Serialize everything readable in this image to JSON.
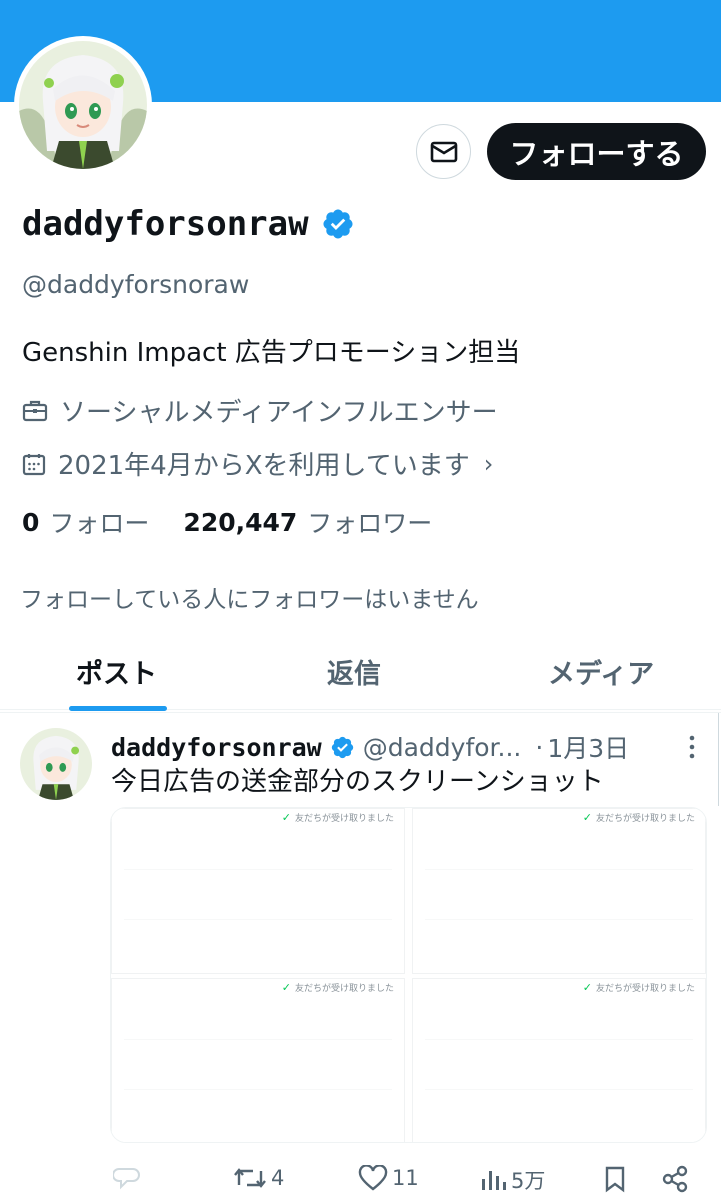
{
  "profile": {
    "display_name": "daddyforsonraw",
    "handle": "@daddyforsnoraw",
    "bio": "Genshin Impact 広告プロモーション担当",
    "category": "ソーシャルメディアインフルエンサー",
    "joined": "2021年4月からXを利用しています",
    "joined_chevron": "›",
    "following_count": "0",
    "following_label": "フォロー",
    "followers_count": "220,447",
    "followers_label": "フォロワー",
    "mutual_note": "フォローしている人にフォロワーはいません",
    "follow_button": "フォローする",
    "message_icon": "envelope-icon",
    "verified_icon": "verified-badge-icon",
    "banner_color": "#1d9bf0"
  },
  "tabs": [
    {
      "label": "ポスト",
      "active": true
    },
    {
      "label": "返信",
      "active": false
    },
    {
      "label": "メディア",
      "active": false
    }
  ],
  "post": {
    "name": "daddyforsonraw",
    "handle": "@daddyfor...",
    "dot": "·",
    "time": "1月3日",
    "text": "今日広告の送金部分のスクリーンショット",
    "images": [
      {
        "caption": "友だちが受け取りました"
      },
      {
        "caption": "友だちが受け取りました"
      },
      {
        "caption": "友だちが受け取りました"
      },
      {
        "caption": "友だちが受け取りました"
      }
    ],
    "actions": {
      "reply_count": "",
      "repost_count": "4",
      "like_count": "11",
      "views_count": "5万"
    }
  },
  "colors": {
    "accent": "#1d9bf0",
    "text_primary": "#0f1419",
    "text_secondary": "#536471",
    "received_check": "#06c755"
  }
}
